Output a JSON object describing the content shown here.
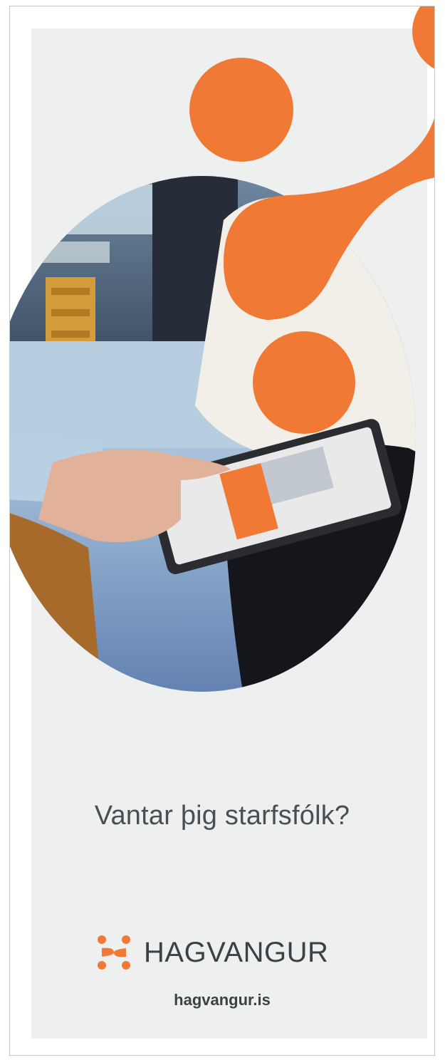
{
  "poster": {
    "tagline": "Vantar þig starfsfólk?",
    "brand": "HAGVANGUR",
    "url": "hagvangur.is"
  },
  "colors": {
    "accent": "#f07a35",
    "panel": "#eef0f0",
    "text": "#4a4f55"
  },
  "icons": {
    "logo": "hagvangur-network-logo"
  }
}
